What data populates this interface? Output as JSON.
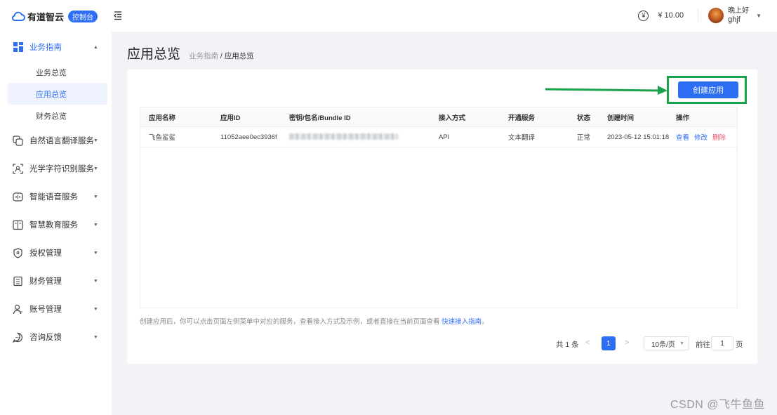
{
  "topbar": {
    "brand": "有道智云",
    "console_badge": "控制台",
    "balance": "¥ 10.00",
    "greeting": "晚上好",
    "username": "ghjf"
  },
  "sidebar": {
    "groups": [
      {
        "label": "业务指南",
        "icon": "grid-icon",
        "expanded": true,
        "children": [
          {
            "label": "业务总览"
          },
          {
            "label": "应用总览"
          },
          {
            "label": "财务总览"
          }
        ]
      },
      {
        "label": "自然语言翻译服务",
        "icon": "translate-icon"
      },
      {
        "label": "光学字符识别服务",
        "icon": "scan-icon"
      },
      {
        "label": "智能语音服务",
        "icon": "voice-icon"
      },
      {
        "label": "智慧教育服务",
        "icon": "education-icon"
      },
      {
        "label": "授权管理",
        "icon": "shield-icon"
      },
      {
        "label": "财务管理",
        "icon": "finance-icon"
      },
      {
        "label": "账号管理",
        "icon": "user-icon"
      },
      {
        "label": "咨询反馈",
        "icon": "chat-icon"
      }
    ]
  },
  "main": {
    "title": "应用总览",
    "breadcrumb": {
      "parent": "业务指南",
      "separator": " / ",
      "current": "应用总览"
    },
    "create_button": "创建应用",
    "table": {
      "headers": [
        "应用名称",
        "应用ID",
        "密钥/包名/Bundle ID",
        "接入方式",
        "开通服务",
        "状态",
        "创建时间",
        "操作"
      ],
      "rows": [
        {
          "name": "飞鱼鲨鲨",
          "app_id": "11052aee0ec3936f",
          "access": "API",
          "service": "文本翻译",
          "status": "正常",
          "created": "2023-05-12 15:01:18",
          "actions": {
            "view": "查看",
            "edit": "修改",
            "delete": "删除"
          }
        }
      ]
    },
    "hint_text": "创建应用后，你可以点击页面左侧菜单中对应的服务，查看接入方式及示例，或者直接在当前页面查看 ",
    "hint_link": "快速接入指南",
    "hint_end": "。",
    "pagination": {
      "total": "共 1 条",
      "current_page": "1",
      "page_size": "10条/页",
      "goto_label": "前往",
      "goto_value": "1",
      "page_unit": "页"
    }
  },
  "watermark": "CSDN @飞牛鱼鱼",
  "colors": {
    "accent": "#2d6ef5",
    "highlight_box": "#1aa34a",
    "danger": "#f0546a"
  }
}
